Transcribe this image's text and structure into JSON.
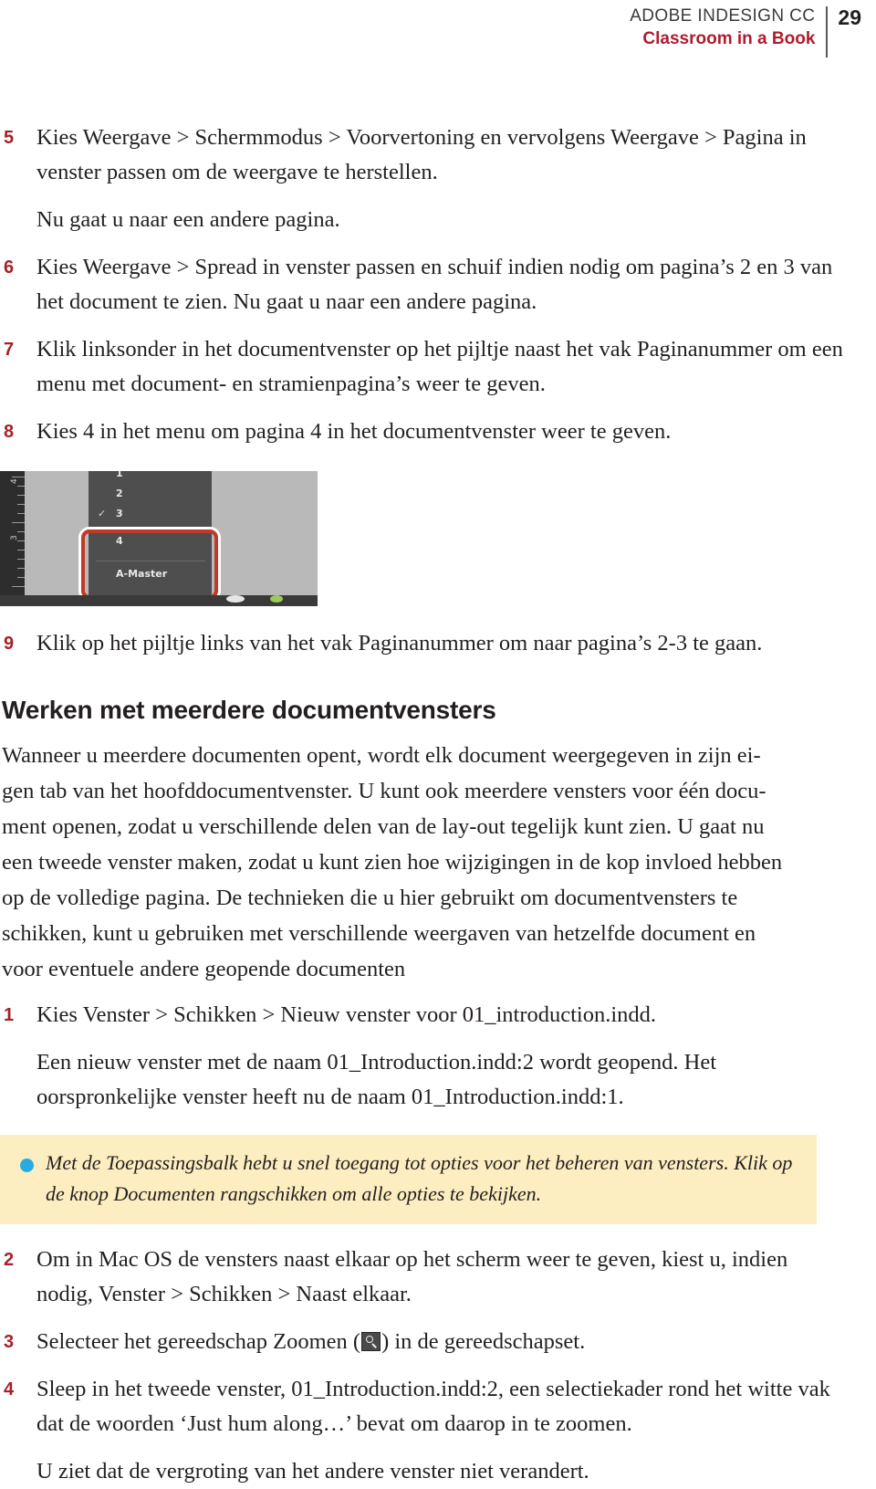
{
  "header": {
    "product": "ADOBE INDESIGN CC",
    "series": "Classroom in a Book",
    "page_number": "29"
  },
  "steps_first_group": [
    {
      "num": "5",
      "text": "Kies Weergave > Schermmodus > Voorvertoning en vervolgens Weergave > Pagina in venster passen om de weergave te herstellen."
    },
    {
      "num": "6",
      "text": "Kies Weergave > Spread in venster passen en schuif indien nodig om pagina’s 2 en 3 van het document te zien. Nu gaat u naar een andere pagina."
    },
    {
      "num": "7",
      "text": "Klik linksonder in het documentvenster op het pijltje naast het vak Paginanummer om een menu met document- en stramienpagina’s weer te geven."
    },
    {
      "num": "8",
      "text": "Kies 4 in het menu om pagina 4 in het documentvenster weer te geven."
    },
    {
      "num": "9",
      "text": "Klik op het pijltje links van het vak Paginanummer om naar pagina’s 2-3 te gaan."
    }
  ],
  "note_after_step5": "Nu gaat u naar een andere pagina.",
  "figure": {
    "caption_alt": "InDesign paginanummer-menu schermafbeelding",
    "menu_items": [
      "1",
      "2",
      "3",
      "4",
      "A-Master"
    ],
    "ruler_labels": [
      "4",
      "3"
    ],
    "highlight_color": "#c0392b"
  },
  "section": {
    "heading": "Werken met meerdere documentvensters",
    "paragraphs": [
      "Wanneer u meerdere documenten opent, wordt elk document weergegeven in zijn ei-",
      "gen tab van het hoofddocumentvenster. U kunt ook meerdere vensters voor één docu-",
      "ment openen, zodat u verschillende delen van de lay-out tegelijk kunt zien. U gaat nu",
      "een tweede venster maken, zodat u kunt zien hoe wijzigingen in de kop invloed hebben",
      "op de volledige pagina. De technieken die u hier gebruikt om documentvensters te",
      "schikken, kunt u gebruiken met verschillende weergaven van hetzelfde document en",
      "voor eventuele andere geopende documenten"
    ]
  },
  "steps_second_group": [
    {
      "num": "1",
      "text": "Kies Venster > Schikken > Nieuw venster voor 01_introduction.indd."
    },
    {
      "num": "2",
      "text": "Om in Mac OS de vensters naast elkaar op het scherm weer te geven, kiest u, indien nodig, Venster > Schikken > Naast elkaar."
    },
    {
      "num": "3",
      "text_before_icon": "Selecteer het gereedschap Zoomen (",
      "icon": "zoom-tool-icon",
      "text_after_icon": ") in de gereedschapset."
    },
    {
      "num": "4",
      "text": "Sleep in het tweede venster, 01_Introduction.indd:2, een selectiekader rond het witte vak dat de woorden ‘Just hum along…’ bevat om daarop in te zoomen."
    }
  ],
  "note_after_step1": "Een nieuw venster met de naam 01_Introduction.indd:2 wordt geopend. Het oorspronkelijke venster heeft nu de naam 01_Introduction.indd:1.",
  "note_after_step4": "U ziet dat de vergroting van het andere venster niet verandert.",
  "tip": {
    "text": "Met de Toepassingsbalk hebt u snel toegang tot opties voor het beheren van vensters. Klik op de knop Documenten rangschikken om alle opties te bekijken.",
    "bullet_color": "#28abe2",
    "background_color": "#fceec0"
  },
  "colors": {
    "accent_red": "#b01c2e",
    "step_number_red": "#a81f26",
    "body_text": "#231f20"
  }
}
